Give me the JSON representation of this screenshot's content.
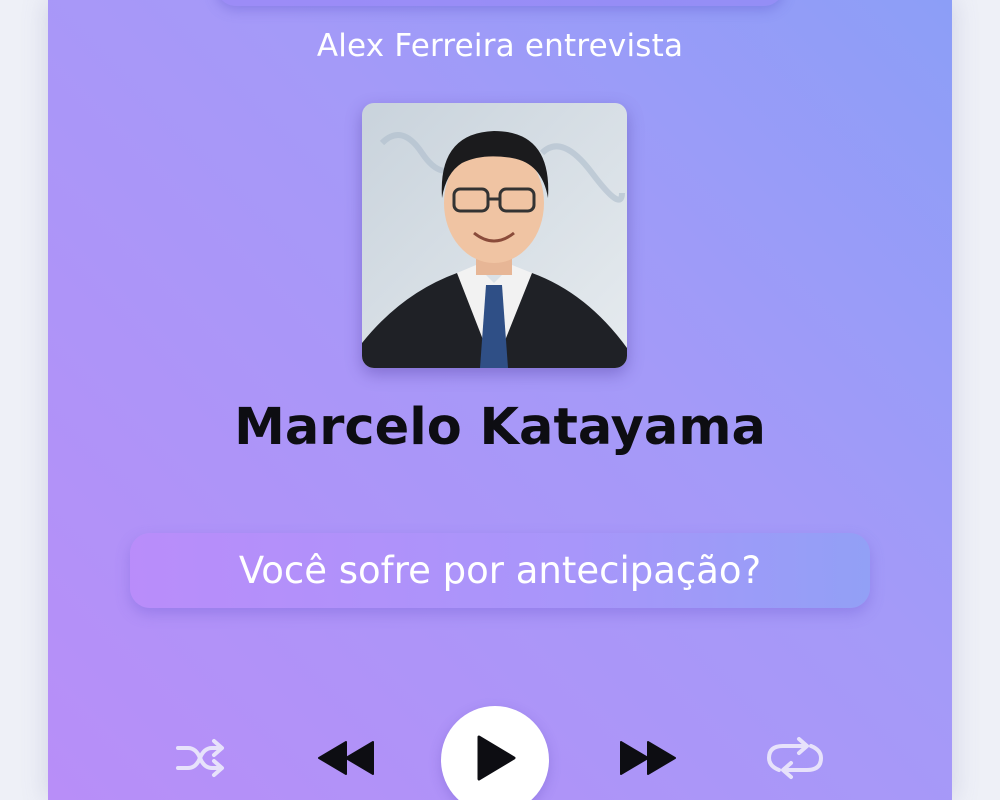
{
  "header": {
    "subtitle": "Alex Ferreira entrevista"
  },
  "guest": {
    "name": "Marcelo Katayama"
  },
  "episode": {
    "title": "Você sofre por antecipação?"
  },
  "controls": {
    "shuffle_icon": "shuffle-icon",
    "previous_icon": "rewind-icon",
    "play_icon": "play-icon",
    "next_icon": "fast-forward-icon",
    "repeat_icon": "repeat-icon"
  },
  "colors": {
    "gradient_start": "#b88ef8",
    "gradient_end": "#8c9ef7",
    "name_text": "#0d0d12",
    "subtitle_text": "#ffffff"
  }
}
